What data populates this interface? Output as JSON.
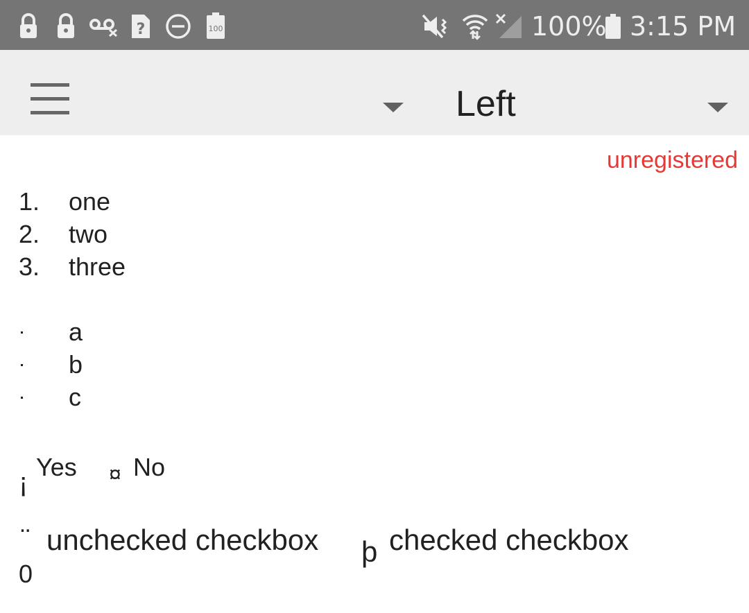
{
  "status_bar": {
    "battery_percent": "100%",
    "time": "3:15 PM",
    "battery_saver_label": "100",
    "icons": [
      "lock-icon",
      "lock-icon",
      "voicemail-icon",
      "unknown-file-icon",
      "do-not-disturb-icon",
      "battery-100-icon",
      "mute-vibrate-icon",
      "wifi-icon",
      "no-signal-icon",
      "battery-icon"
    ]
  },
  "app_bar": {
    "title": "Left",
    "menu_icon": "hamburger-menu-icon",
    "dropdown_icon": "caret-down-icon"
  },
  "content": {
    "status_label": "unregistered",
    "status_color": "#e53935",
    "ordered_list": [
      {
        "marker": "1.",
        "text": "one"
      },
      {
        "marker": "2.",
        "text": "two"
      },
      {
        "marker": "3.",
        "text": "three"
      }
    ],
    "bullet_list": [
      {
        "text": "a"
      },
      {
        "text": "b"
      },
      {
        "text": "c"
      }
    ],
    "radio_options": [
      {
        "glyph": "¡",
        "label": "Yes"
      },
      {
        "glyph": "¤",
        "label": "No"
      }
    ],
    "checkboxes": [
      {
        "glyph_top": "¨",
        "glyph_bottom": "0",
        "label": "unchecked checkbox"
      },
      {
        "glyph": "þ",
        "label": "checked checkbox"
      }
    ]
  }
}
